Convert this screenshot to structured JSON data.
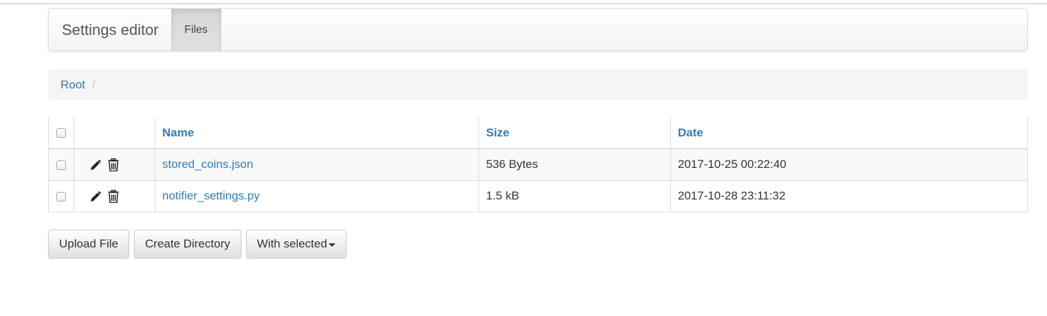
{
  "navbar": {
    "brand": "Settings editor",
    "tab": "Files"
  },
  "breadcrumb": {
    "root_label": "Root",
    "separator": "/"
  },
  "table": {
    "headers": {
      "name": "Name",
      "size": "Size",
      "date": "Date"
    },
    "rows": [
      {
        "name": "stored_coins.json",
        "size": "536 Bytes",
        "date": "2017-10-25 00:22:40"
      },
      {
        "name": "notifier_settings.py",
        "size": "1.5 kB",
        "date": "2017-10-28 23:11:32"
      }
    ]
  },
  "actions": {
    "upload": "Upload File",
    "create_dir": "Create Directory",
    "with_selected": "With selected"
  },
  "icons": {
    "edit": "pencil-icon",
    "delete": "trash-icon",
    "dropdown": "caret-down-icon"
  },
  "colors": {
    "link": "#337ab7",
    "breadcrumb_bg": "#f5f5f5",
    "active_tab_bg": "#d6d6d6"
  }
}
